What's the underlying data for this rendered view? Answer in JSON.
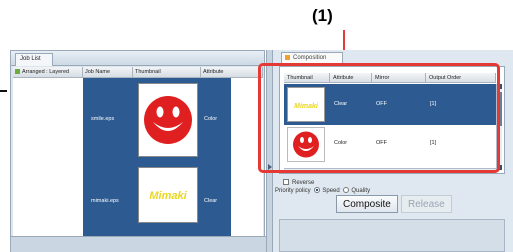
{
  "callout": "(1)",
  "job_list": {
    "tab_label": "Job List",
    "columns": [
      "Arranged : Layered",
      "Job Name",
      "Thumbnail",
      "Attribute"
    ],
    "rows": [
      {
        "job_name": "smile.eps",
        "thumbnail": "smiley-face",
        "attribute": "Color"
      },
      {
        "job_name": "mimaki.eps",
        "thumbnail": "mimaki-logo",
        "attribute": "Clear"
      }
    ]
  },
  "composition": {
    "tab_label": "Composition",
    "columns": [
      "Thumbnail",
      "Attribute",
      "Mirror",
      "Output Order"
    ],
    "rows": [
      {
        "thumbnail": "mimaki-logo",
        "attribute": "Clear",
        "mirror": "OFF",
        "order": "[1]"
      },
      {
        "thumbnail": "smiley-face",
        "attribute": "Color",
        "mirror": "OFF",
        "order": "[1]"
      }
    ],
    "reverse_label": "Reverse",
    "priority_label": "Priority policy",
    "speed_label": "Speed",
    "quality_label": "Quality",
    "composite_button": "Composite",
    "release_button": "Release"
  },
  "colors": {
    "selection": "#2c5a91",
    "highlight": "#e53935",
    "logo": "#e8d820",
    "smiley": "#e02020"
  }
}
